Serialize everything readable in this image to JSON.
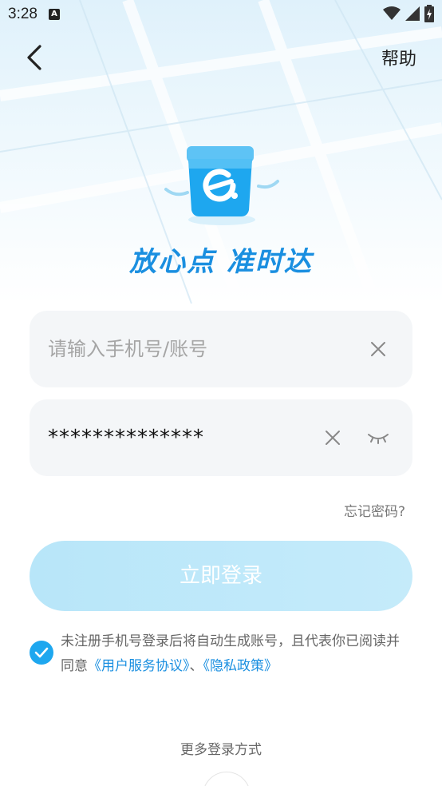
{
  "status_bar": {
    "time": "3:28",
    "notification_icon": "A"
  },
  "header": {
    "help_label": "帮助"
  },
  "brand": {
    "slogan": "放心点 准时达",
    "accent_color": "#1a8fe0"
  },
  "form": {
    "phone_placeholder": "请输入手机号/账号",
    "password_value": "**************",
    "forgot_label": "忘记密码?",
    "login_label": "立即登录"
  },
  "agreement": {
    "checked": true,
    "text_before": "未注册手机号登录后将自动生成账号，且代表你已阅读并同意",
    "user_agreement": "《用户服务协议》",
    "separator": "、",
    "privacy_policy": "《隐私政策》"
  },
  "more_login": {
    "label": "更多登录方式"
  }
}
